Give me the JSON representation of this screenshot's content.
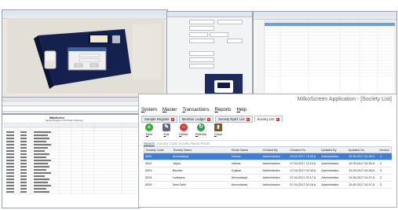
{
  "app": {
    "title": "MilkoScreen Application - [Society List]",
    "menu": [
      "System",
      "Master",
      "Transactions",
      "Reports",
      "Help"
    ],
    "tabs": [
      {
        "label": "Sample Register",
        "active": false
      },
      {
        "label": "Member Ledger",
        "active": false
      },
      {
        "label": "Society Rpt/4 List",
        "active": false
      },
      {
        "label": "Society List",
        "active": true
      }
    ],
    "toolbar": [
      {
        "label": "New",
        "icon": "plus-icon",
        "color": "#3aa93a",
        "glyph": "+"
      },
      {
        "label": "Edit",
        "icon": "edit-icon",
        "color": "#5b6a7a",
        "glyph": "✎"
      },
      {
        "label": "Delete",
        "icon": "delete-icon",
        "color": "#d23b3b",
        "glyph": "−"
      },
      {
        "label": "Refresh",
        "icon": "refresh-icon",
        "color": "#2e9a45",
        "glyph": "↻"
      },
      {
        "label": "Close",
        "icon": "close-icon",
        "color": "#7a5a2a",
        "glyph": "▮"
      }
    ],
    "search": {
      "label": "Search",
      "placeholder": "Society Code Society Name Route"
    },
    "grid": {
      "columns": [
        "Society Code",
        "Society Name",
        "Route Name",
        "Created By",
        "Created On",
        "Updated By",
        "Updated On",
        "Version"
      ],
      "rows": [
        [
          "0001",
          "Ahmedabad",
          "Vrdhas",
          "Administrator",
          "26.02.2017 10:39 A",
          "Administrator",
          "19.05.2017 04:35 A",
          "1"
        ],
        [
          "0002",
          "Jaipur",
          "Vrdhas",
          "Administrator",
          "07.04.2017 12:19 A",
          "Administrator",
          "19.05.2017 04:36 A",
          "2"
        ],
        [
          "0003",
          "Baroda",
          "Gujarat",
          "Administrator",
          "07.04.2017 02:34 A",
          "Administrator",
          "19.05.2017 04:36 A",
          "3"
        ],
        [
          "0004",
          "Ludhiana",
          "Ahmedabad",
          "Administrator",
          "07.04.2017 02:17 A",
          "Administrator",
          "19.05.2017 04:37 A",
          "3"
        ],
        [
          "0005",
          "New Delhi",
          "Ahmedabad",
          "Administrator",
          "07.04.2017 02:16 A",
          "Administrator",
          "19.05.2017 04:37 A",
          "2"
        ]
      ],
      "selected_row": 0
    }
  },
  "report": {
    "title": "MilkoScreen",
    "subtitle": "Sample Register of 16.02.2017 (Morning)"
  },
  "colors": {
    "selection": "#3d7fd8",
    "device_body": "#14214f",
    "tab_close": "#d62a2a"
  }
}
